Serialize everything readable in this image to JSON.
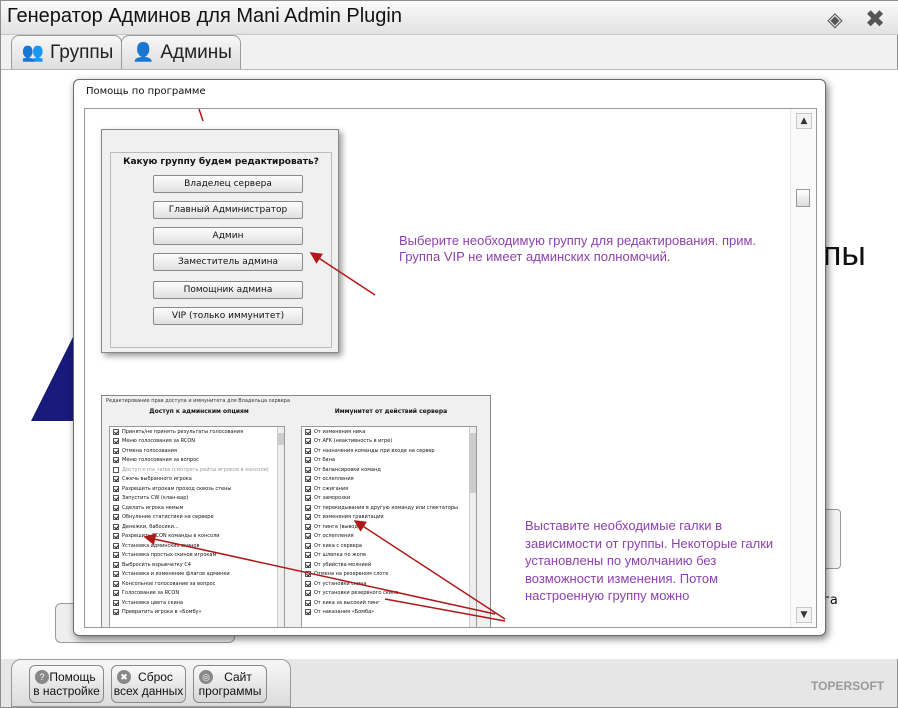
{
  "window": {
    "title": "Генератор Админов для Mani Admin Plugin",
    "brand": "TOPERSOFT"
  },
  "tabs": [
    {
      "label": "Группы",
      "icon": "users-icon"
    },
    {
      "label": "Админы",
      "icon": "user-icon"
    }
  ],
  "background": {
    "heading_fragment": "пы",
    "side_fragment": "га"
  },
  "dialog": {
    "title": "Помощь по программе",
    "group_picker": {
      "question": "Какую группу будем редактировать?",
      "buttons": [
        "Владелец сервера",
        "Главный Администратор",
        "Админ",
        "Заместитель админа",
        "Помощник админа",
        "VIP (только иммунитет)"
      ]
    },
    "note1": "Выберите необходимую группу для редактирования. прим. Группа VIP не имеет админских полномочий.",
    "rights_editor": {
      "header": "Редактирование прав доступа и иммунитета для Владельца сервера",
      "left_title": "Доступ к админским опциям",
      "right_title": "Иммунитет от действий сервера",
      "left_items": [
        {
          "label": "Принять/не принять результаты голосования",
          "checked": true
        },
        {
          "label": "Меню голосования за RCON",
          "checked": true
        },
        {
          "label": "Отмена голосования",
          "checked": true
        },
        {
          "label": "Меню голосования за вопрос",
          "checked": true
        },
        {
          "label": "Доступ к ma_rates (смотреть рейты игроков в консоли)",
          "checked": false,
          "disabled": true
        },
        {
          "label": "Сжечь выбранного игрока",
          "checked": true
        },
        {
          "label": "Разрешить игрокам проход сквозь стены",
          "checked": true
        },
        {
          "label": "Запустить CW (клан-вар)",
          "checked": true
        },
        {
          "label": "Сделать игрока немым",
          "checked": true
        },
        {
          "label": "Обнуление статистики на сервере",
          "checked": true
        },
        {
          "label": "Денежки, бабосики...",
          "checked": true
        },
        {
          "label": "Разрешить RCON команды в консоли",
          "checked": true
        },
        {
          "label": "Установка админских скинов",
          "checked": true
        },
        {
          "label": "Установка простых скинов игрокам",
          "checked": true
        },
        {
          "label": "Выбросить взрывчатку С4",
          "checked": true
        },
        {
          "label": "Установка и изменение флагов админки",
          "checked": true
        },
        {
          "label": "Консольное голосование за вопрос",
          "checked": true
        },
        {
          "label": "Голосование за RCON",
          "checked": true
        },
        {
          "label": "Установка цвета скина",
          "checked": true
        },
        {
          "label": "Превратить игрока в «Бомбу»",
          "checked": true
        }
      ],
      "right_items": [
        {
          "label": "От изменения ника",
          "checked": true
        },
        {
          "label": "От AFK (неактивность в игре)",
          "checked": true
        },
        {
          "label": "От назначения команды при входе на сервер",
          "checked": true
        },
        {
          "label": "От бана",
          "checked": true
        },
        {
          "label": "От балансировки команд",
          "checked": true
        },
        {
          "label": "От ослепления",
          "checked": true
        },
        {
          "label": "От сжигания",
          "checked": true
        },
        {
          "label": "От заморозки",
          "checked": true
        },
        {
          "label": "От перекидывания в другую команду или спектаторы",
          "checked": true
        },
        {
          "label": "От изменения гравитации",
          "checked": true
        },
        {
          "label": "От пинга (вывода)",
          "checked": true
        },
        {
          "label": "От ослепления",
          "checked": true
        },
        {
          "label": "От кика с сервера",
          "checked": true
        },
        {
          "label": "От шлепка по жопе",
          "checked": true
        },
        {
          "label": "От убийства молнией",
          "checked": true
        },
        {
          "label": "Отмена на резервном слоте",
          "checked": true
        },
        {
          "label": "От установки скина",
          "checked": true
        },
        {
          "label": "От установки резервного скина",
          "checked": true
        },
        {
          "label": "От кика за высокий пинг",
          "checked": true
        },
        {
          "label": "От наказания «Бомба»",
          "checked": true
        }
      ]
    },
    "note2": "Выставите необходимые галки в зависимости от группы. Некоторые галки установлены по умолчанию без возможности изменения. Потом настроенную группу можно"
  },
  "bottom_buttons": [
    {
      "label1": "Помощь",
      "label2": "в настройке",
      "icon": "help-icon"
    },
    {
      "label1": "Сброс",
      "label2": "всех данных",
      "icon": "reset-icon"
    },
    {
      "label1": "Сайт",
      "label2": "программы",
      "icon": "globe-icon"
    }
  ]
}
